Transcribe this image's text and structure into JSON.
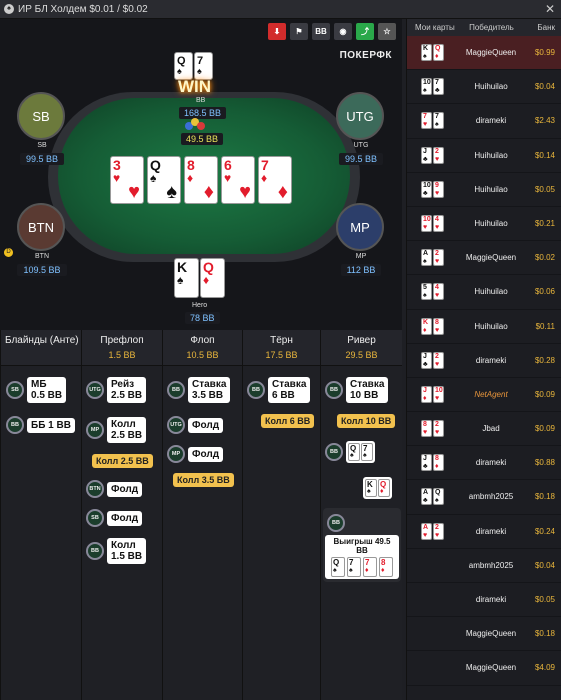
{
  "window": {
    "title": "ИР БЛ Холдем $0.01 / $0.02",
    "close": "✕"
  },
  "toolbar": {
    "download": "⬇",
    "flag": "⚑",
    "bb": "BB",
    "spy": "◉",
    "share": "⤴",
    "star": "☆"
  },
  "brand": "ПОКЕРФК",
  "seats": {
    "bb": {
      "name": "BB",
      "stack": "168.5 BB"
    },
    "sb": {
      "avatar": "SB",
      "name": "SB",
      "stack": "99.5 BB"
    },
    "utg": {
      "avatar": "UTG",
      "name": "UTG",
      "stack": "99.5 BB"
    },
    "btn": {
      "avatar": "BTN",
      "name": "BTN",
      "stack": "109.5 BB"
    },
    "mp": {
      "avatar": "MP",
      "name": "MP",
      "stack": "112 BB"
    },
    "hero": {
      "name": "Hero",
      "stack": "78 BB"
    }
  },
  "win_label": "WIN",
  "pot": "49.5 BB",
  "dealer": "D",
  "bb_cards": [
    {
      "r": "Q",
      "s": "♠"
    },
    {
      "r": "7",
      "s": "♠"
    }
  ],
  "hero_cards": [
    {
      "r": "K",
      "s": "♠"
    },
    {
      "r": "Q",
      "s": "♦"
    }
  ],
  "board": [
    {
      "r": "3",
      "s": "♥"
    },
    {
      "r": "Q",
      "s": "♠"
    },
    {
      "r": "8",
      "s": "♦"
    },
    {
      "r": "6",
      "s": "♥"
    },
    {
      "r": "7",
      "s": "♦"
    }
  ],
  "streets": [
    {
      "name": "Блайнды (Анте)",
      "pot": ""
    },
    {
      "name": "Префлоп",
      "pot": "1.5 BB"
    },
    {
      "name": "Флоп",
      "pot": "10.5 BB"
    },
    {
      "name": "Тёрн",
      "pot": "17.5 BB"
    },
    {
      "name": "Ривер",
      "pot": "29.5 BB"
    }
  ],
  "actions": {
    "blinds": [
      {
        "pos": "SB",
        "text1": "МБ",
        "text2": "0.5 BB"
      },
      {
        "pos": "BB",
        "text1": "ББ 1 BB",
        "text2": ""
      }
    ],
    "preflop": [
      {
        "pos": "UTG",
        "text1": "Рейз",
        "text2": "2.5 BB"
      },
      {
        "pos": "MP",
        "text1": "Колл",
        "text2": "2.5 BB"
      },
      {
        "pos": "BTN",
        "text1": "Фолд",
        "text2": ""
      },
      {
        "pos": "SB",
        "text1": "Фолд",
        "text2": ""
      },
      {
        "pos": "BB",
        "text1": "Колл",
        "text2": "1.5 BB"
      }
    ],
    "preflop_call": "Колл 2.5 BB",
    "flop": [
      {
        "pos": "BB",
        "text1": "Ставка",
        "text2": "3.5 BB"
      },
      {
        "pos": "UTG",
        "text1": "Фолд",
        "text2": ""
      },
      {
        "pos": "MP",
        "text1": "Фолд",
        "text2": ""
      }
    ],
    "flop_call": "Колл 3.5 BB",
    "turn": [
      {
        "pos": "BB",
        "text1": "Ставка",
        "text2": "6 BB"
      }
    ],
    "turn_call": "Колл 6 BB",
    "river": [
      {
        "pos": "BB",
        "text1": "Ставка",
        "text2": "10 BB"
      }
    ],
    "river_call": "Колл 10 BB",
    "river_bb_pos": "BB",
    "river_show_cards": [
      {
        "r": "Q",
        "s": "♠"
      },
      {
        "r": "7",
        "s": "♠"
      }
    ],
    "river_hero_cards": [
      {
        "r": "K",
        "s": "♠"
      },
      {
        "r": "Q",
        "s": "♦"
      }
    ],
    "river_win_pos": "BB",
    "river_win_label": "Выигрыш 49.5 BB",
    "river_win_cards": [
      {
        "r": "Q",
        "s": "♠"
      },
      {
        "r": "7",
        "s": "♠"
      },
      {
        "r": "7",
        "s": "♦"
      },
      {
        "r": "8",
        "s": "♦"
      }
    ]
  },
  "side": {
    "headers": [
      "Мои карты",
      "Победитель",
      "Банк"
    ],
    "rows": [
      {
        "c1": {
          "r": "K",
          "s": "♠"
        },
        "c2": {
          "r": "Q",
          "s": "♦"
        },
        "winner": "MaggieQueen",
        "bank": "$0.99",
        "selected": true
      },
      {
        "c1": {
          "r": "10",
          "s": "♠"
        },
        "c2": {
          "r": "7",
          "s": "♣"
        },
        "winner": "Huihuilao",
        "bank": "$0.04"
      },
      {
        "c1": {
          "r": "7",
          "s": "♥"
        },
        "c2": {
          "r": "7",
          "s": "♠"
        },
        "winner": "dirameki",
        "bank": "$2.43"
      },
      {
        "c1": {
          "r": "J",
          "s": "♣"
        },
        "c2": {
          "r": "2",
          "s": "♥"
        },
        "winner": "Huihuilao",
        "bank": "$0.14"
      },
      {
        "c1": {
          "r": "10",
          "s": "♣"
        },
        "c2": {
          "r": "9",
          "s": "♥"
        },
        "winner": "Huihuilao",
        "bank": "$0.05"
      },
      {
        "c1": {
          "r": "10",
          "s": "♥"
        },
        "c2": {
          "r": "4",
          "s": "♥"
        },
        "winner": "Huihuilao",
        "bank": "$0.21"
      },
      {
        "c1": {
          "r": "A",
          "s": "♠"
        },
        "c2": {
          "r": "2",
          "s": "♥"
        },
        "winner": "MaggieQueen",
        "bank": "$0.02"
      },
      {
        "c1": {
          "r": "5",
          "s": "♠"
        },
        "c2": {
          "r": "4",
          "s": "♥"
        },
        "winner": "Huihuilao",
        "bank": "$0.06"
      },
      {
        "c1": {
          "r": "K",
          "s": "♦"
        },
        "c2": {
          "r": "8",
          "s": "♥"
        },
        "winner": "Huihuilao",
        "bank": "$0.11"
      },
      {
        "c1": {
          "r": "J",
          "s": "♣"
        },
        "c2": {
          "r": "2",
          "s": "♥"
        },
        "winner": "dirameki",
        "bank": "$0.28"
      },
      {
        "c1": {
          "r": "J",
          "s": "♦"
        },
        "c2": {
          "r": "10",
          "s": "♥"
        },
        "winner": "NetAgent",
        "bank": "$0.09",
        "agent": true
      },
      {
        "c1": {
          "r": "8",
          "s": "♥"
        },
        "c2": {
          "r": "2",
          "s": "♥"
        },
        "winner": "Jbad",
        "bank": "$0.09"
      },
      {
        "c1": {
          "r": "J",
          "s": "♣"
        },
        "c2": {
          "r": "8",
          "s": "♦"
        },
        "winner": "dirameki",
        "bank": "$0.88"
      },
      {
        "c1": {
          "r": "A",
          "s": "♣"
        },
        "c2": {
          "r": "Q",
          "s": "♠"
        },
        "winner": "ambmh2025",
        "bank": "$0.18"
      },
      {
        "c1": {
          "r": "A",
          "s": "♥"
        },
        "c2": {
          "r": "2",
          "s": "♥"
        },
        "winner": "dirameki",
        "bank": "$0.24"
      },
      {
        "c1": null,
        "c2": null,
        "winner": "ambmh2025",
        "bank": "$0.04"
      },
      {
        "c1": null,
        "c2": null,
        "winner": "dirameki",
        "bank": "$0.05"
      },
      {
        "c1": null,
        "c2": null,
        "winner": "MaggieQueen",
        "bank": "$0.18"
      },
      {
        "c1": null,
        "c2": null,
        "winner": "MaggieQueen",
        "bank": "$4.09"
      }
    ]
  }
}
